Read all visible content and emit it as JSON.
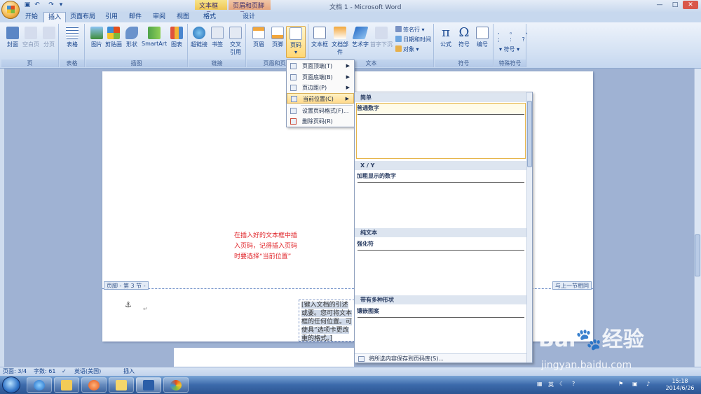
{
  "titlebar": {
    "title": "文档 1 - Microsoft Word",
    "contextual_tabs": [
      "文本框工具",
      "页眉和页脚工具"
    ],
    "window_buttons": [
      "—",
      "□",
      "✕"
    ]
  },
  "tabs": [
    {
      "label": "开始",
      "active": false
    },
    {
      "label": "插入",
      "active": true
    },
    {
      "label": "页面布局",
      "active": false
    },
    {
      "label": "引用",
      "active": false
    },
    {
      "label": "邮件",
      "active": false
    },
    {
      "label": "审阅",
      "active": false
    },
    {
      "label": "视图",
      "active": false
    },
    {
      "label": "格式",
      "active": false
    },
    {
      "label": "设计",
      "active": false
    }
  ],
  "ribbon": {
    "groups": {
      "pages": "页",
      "tables": "表格",
      "illustrations": "插图",
      "links": "链接",
      "header_footer": "页眉和页脚",
      "text": "文本",
      "symbols": "符号",
      "special_symbols": "特殊符号"
    },
    "buttons": {
      "cover": "封面",
      "blank_page": "空白页",
      "page_break": "分页",
      "table": "表格",
      "picture": "图片",
      "clipart": "剪贴画",
      "shapes": "形状",
      "smartart": "SmartArt",
      "chart": "图表",
      "hyperlink": "超链接",
      "bookmark": "书签",
      "cross_ref": "交叉\n引用",
      "header": "页眉",
      "footer": "页脚",
      "page_number": "页码",
      "textbox": "文本框",
      "quick_parts": "文档部件",
      "wordart": "艺术字",
      "dropcap": "首字下沉",
      "signature": "签名行",
      "datetime": "日期和时间",
      "object": "对象",
      "equation": "公式",
      "symbol": "符号",
      "numbering": "编号",
      "special_symbol": "符号"
    }
  },
  "document": {
    "note": "在插入好的文本框中插入页码，记得插入页码时要选择“当前位置”",
    "footer_label": "页脚 - 第 3 节 -",
    "same_as_previous": "与上一节相同",
    "textbox_text": "[键入文档的引述或要。您可将文本框的任何位置。可使具”选项卡更改重的格式。]"
  },
  "menu": {
    "items": [
      {
        "label": "页面顶端(T)",
        "submenu": true
      },
      {
        "label": "页面底端(B)",
        "submenu": true
      },
      {
        "label": "页边距(P)",
        "submenu": true
      },
      {
        "label": "当前位置(C)",
        "submenu": true,
        "selected": true
      },
      {
        "label": "设置页码格式(F)...",
        "submenu": false
      },
      {
        "label": "删除页码(R)",
        "submenu": false
      }
    ]
  },
  "gallery": {
    "sections": [
      {
        "header": "简单",
        "name": "普通数字"
      },
      {
        "header": "X / Y",
        "name": "加粗显示的数字"
      },
      {
        "header": "纯文本",
        "name": "强化符"
      },
      {
        "header": "带有多种形状",
        "name": "镶嵌图案"
      }
    ],
    "footer": "将所选内容保存到页码库(S)..."
  },
  "status": {
    "page": "页面: 3/4",
    "words": "字数: 61",
    "language": "英语(美国)",
    "mode": "插入"
  },
  "taskbar": {
    "ime": "英",
    "time": "15:18",
    "date": "2014/6/26"
  },
  "watermark": {
    "brand": "Bai",
    "brand2": "经验",
    "url": "jingyan.baidu.com"
  }
}
